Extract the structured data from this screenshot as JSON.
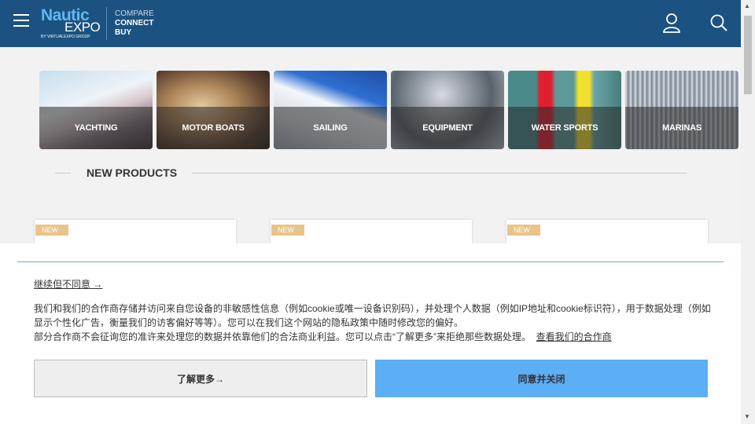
{
  "header": {
    "logo_nautic": "Nautic",
    "logo_expo": "EXPO",
    "logo_group": "BY VIRTUALEXPO GROUP",
    "tagline": [
      "COMPARE",
      "CONNECT",
      "BUY"
    ],
    "icons": [
      "menu-icon",
      "user-icon",
      "search-icon"
    ]
  },
  "categories": [
    {
      "label": "YACHTING"
    },
    {
      "label": "MOTOR BOATS"
    },
    {
      "label": "SAILING"
    },
    {
      "label": "EQUIPMENT"
    },
    {
      "label": "WATER SPORTS"
    },
    {
      "label": "MARINAS"
    }
  ],
  "new_products": {
    "title": "NEW PRODUCTS",
    "badge": "NEW"
  },
  "consent": {
    "continue_link": "继续但不同意 →",
    "text_line1": "我们和我们的合作商存储并访问来自您设备的非敏感性信息（例如cookie或唯一设备识别码），并处理个人数据（例如IP地址和cookie标识符），用于数据处理（例如显示个性化广告，衡量我们的访客偏好等等）。您可以在我们这个网站的隐私政策中随时修改您的偏好。",
    "text_line2": "部分合作商不会征询您的准许来处理您的数据并依靠他们的合法商业利益。您可以点击“了解更多”来拒绝那些数据处理。",
    "partners_link": "查看我们的合作商",
    "learn_more": "了解更多→",
    "agree_close": "同意并关闭"
  },
  "colors": {
    "header_bg": "#1b5281",
    "agree_bg": "#5caef5",
    "badge_bg": "#e8c48a"
  }
}
